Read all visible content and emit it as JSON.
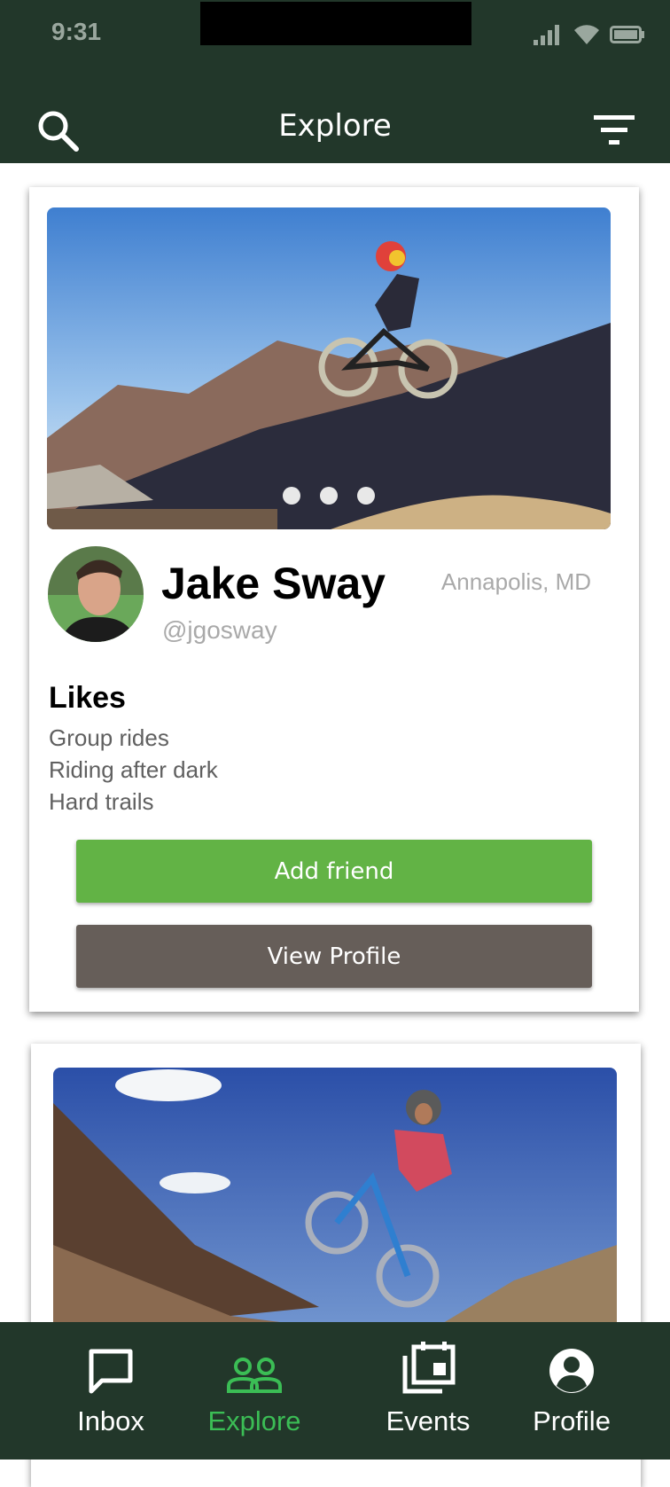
{
  "status_bar": {
    "time": "9:31"
  },
  "header": {
    "title": "Explore",
    "search_icon": "search-icon",
    "filter_icon": "filter-icon"
  },
  "cards": [
    {
      "name": "Jake Sway",
      "handle": "@jgosway",
      "location": "Annapolis, MD",
      "likes_title": "Likes",
      "likes": [
        "Group rides",
        "Riding after dark",
        "Hard trails"
      ],
      "add_friend_label": "Add friend",
      "view_profile_label": "View Profile",
      "carousel_dot_count": 3
    }
  ],
  "bottom_nav": {
    "items": [
      {
        "label": "Inbox",
        "icon": "inbox-icon",
        "active": false
      },
      {
        "label": "Explore",
        "icon": "explore-icon",
        "active": true
      },
      {
        "label": "Events",
        "icon": "events-icon",
        "active": false
      },
      {
        "label": "Profile",
        "icon": "profile-icon",
        "active": false
      }
    ]
  },
  "colors": {
    "header_bg": "#22372a",
    "accent_green": "#62b345",
    "active_nav": "#3bbd55",
    "secondary_button": "#665e59"
  }
}
